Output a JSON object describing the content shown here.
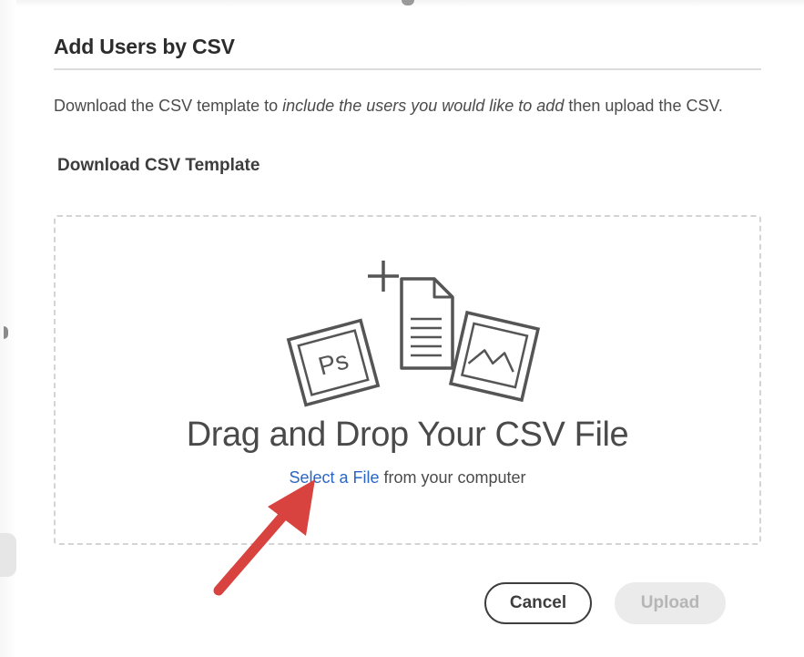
{
  "dialog": {
    "title": "Add Users by CSV",
    "description": {
      "prefix": "Download the CSV template to ",
      "emphasis": "include the users you would like to add",
      "suffix": " then upload the CSV."
    },
    "download_link": "Download CSV Template"
  },
  "dropzone": {
    "title": "Drag and Drop Your CSV File",
    "select_link": "Select a File",
    "select_suffix": " from your computer",
    "ps_label": "Ps",
    "icons": [
      "photoshop-file-icon",
      "add-document-icon",
      "image-file-icon"
    ]
  },
  "buttons": {
    "cancel": "Cancel",
    "upload": "Upload",
    "upload_enabled": false
  },
  "colors": {
    "link": "#2b66c4",
    "arrow": "#d9433f",
    "disabled_button_bg": "#ebebeb",
    "disabled_button_text": "#b6b6b6"
  }
}
